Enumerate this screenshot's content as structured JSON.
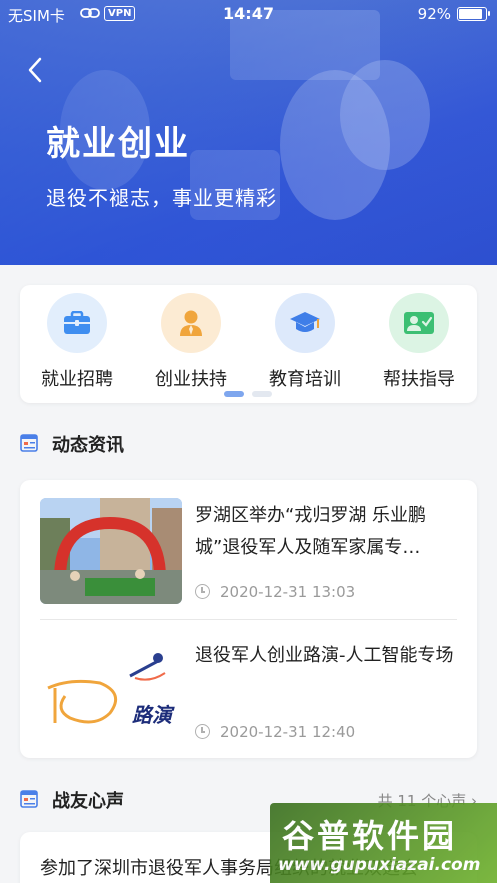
{
  "status_bar": {
    "carrier": "无SIM卡",
    "vpn": "VPN",
    "time": "14:47",
    "battery": "92%",
    "battery_level": 0.92
  },
  "hero": {
    "title": "就业创业",
    "subtitle": "退役不褪志，事业更精彩"
  },
  "menu": {
    "items": [
      {
        "label": "就业招聘",
        "icon": "briefcase-icon",
        "bg": "#e2eefc",
        "color": "#3f8ef0"
      },
      {
        "label": "创业扶持",
        "icon": "person-icon",
        "bg": "#fcebd3",
        "color": "#f0a53c"
      },
      {
        "label": "教育培训",
        "icon": "graduation-cap-icon",
        "bg": "#dde9fb",
        "color": "#3f7ee8"
      },
      {
        "label": "帮扶指导",
        "icon": "user-check-icon",
        "bg": "#dcf4e4",
        "color": "#3cbf73"
      }
    ],
    "page_index": 1,
    "page_count": 2
  },
  "news_section": {
    "title": "动态资讯",
    "items": [
      {
        "title": "罗湖区举办“戎归罗湖 乐业鹏城”退役军人及随军家属专…",
        "date": "2020-12-31 13:03",
        "thumb": "event-photo"
      },
      {
        "title": "退役军人创业路演-人工智能专场",
        "date": "2020-12-31 12:40",
        "thumb": "roadshow-graphic",
        "thumb_text": "路演"
      }
    ]
  },
  "voices_section": {
    "title": "战友心声",
    "more": "共 11 个心声",
    "first_item": "参加了深圳市退役军人事务局组织的就业双选会"
  },
  "watermark": {
    "title": "谷普软件园",
    "url": "www.gupuxiazai.com"
  },
  "colors": {
    "hero_blue": "#3558d6",
    "accent": "#7ea6ee",
    "section_icon": "#4a7fe8",
    "section_icon_accent": "#f06b4a"
  }
}
